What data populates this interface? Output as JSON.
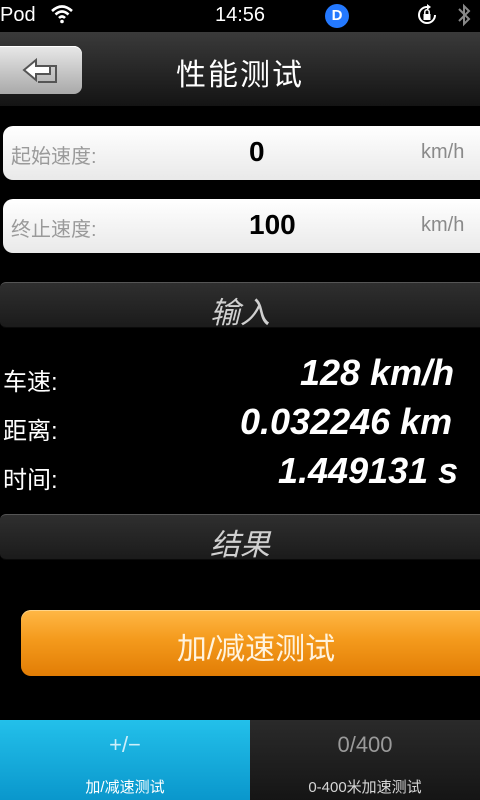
{
  "status_bar": {
    "carrier": "Pod",
    "time": "14:56",
    "badge": "D"
  },
  "nav": {
    "title": "性能测试"
  },
  "inputs": [
    {
      "label": "起始速度:",
      "value": "0",
      "unit": "km/h"
    },
    {
      "label": "终止速度:",
      "value": "100",
      "unit": "km/h"
    }
  ],
  "input_section": {
    "label": "输入"
  },
  "results": [
    {
      "label": "车速:",
      "value": "128 km/h"
    },
    {
      "label": "距离:",
      "value": "0.032246 km"
    },
    {
      "label": "时间:",
      "value": "1.449131 s"
    }
  ],
  "result_section": {
    "label": "结果"
  },
  "action_button": {
    "label": "加/减速测试"
  },
  "tabs": [
    {
      "icon_text": "+/−",
      "label": "加/减速测试",
      "active": true
    },
    {
      "icon_text": "0/400",
      "label": "0-400米加速测试",
      "active": false
    }
  ],
  "colors": {
    "accent_orange": "#f49a1c",
    "tab_active": "#1aaee0",
    "badge_blue": "#2479ff"
  }
}
